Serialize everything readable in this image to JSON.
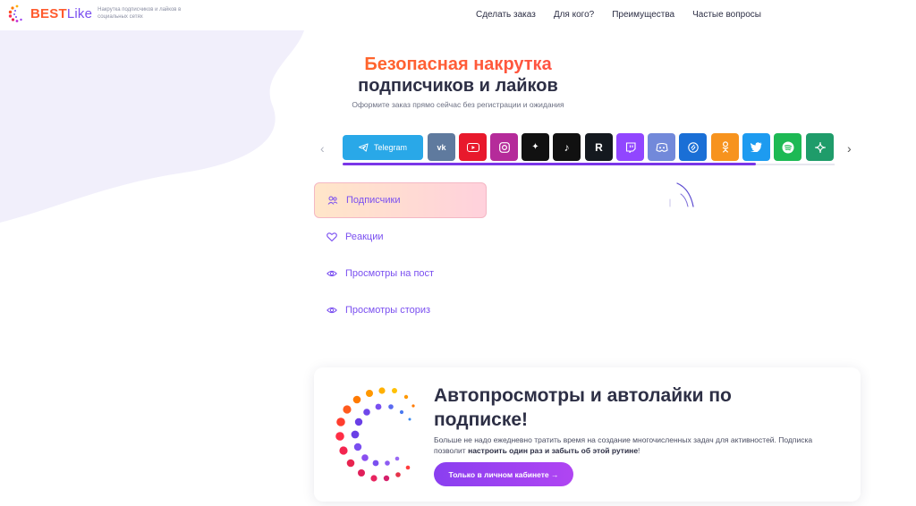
{
  "header": {
    "logo_best": "BEST",
    "logo_like": "Like",
    "tagline": "Накрутка подписчиков и лайков в социальных сетях",
    "nav": [
      "Сделать заказ",
      "Для кого?",
      "Преимущества",
      "Частые вопросы"
    ]
  },
  "hero": {
    "title_line1": "Безопасная накрутка",
    "title_line2": "подписчиков и лайков",
    "subtitle": "Оформите заказ прямо сейчас без регистрации и ожидания"
  },
  "platforms": {
    "selected_label": "Telegram",
    "selected_color": "#29a8e8",
    "items": [
      {
        "icon": "vk-icon",
        "color": "#5f7a9e"
      },
      {
        "icon": "youtube-icon",
        "color": "#e8192c"
      },
      {
        "icon": "instagram-icon",
        "color": "#b52b9a"
      },
      {
        "icon": "threads-icon",
        "color": "#111111"
      },
      {
        "icon": "tiktok-icon",
        "color": "#111111"
      },
      {
        "icon": "rutube-icon",
        "color": "#14191f"
      },
      {
        "icon": "twitch-icon",
        "color": "#9146ff"
      },
      {
        "icon": "discord-icon",
        "color": "#7289da"
      },
      {
        "icon": "shazam-icon",
        "color": "#1a6fd6"
      },
      {
        "icon": "odnoklassniki-icon",
        "color": "#f7931e"
      },
      {
        "icon": "twitter-icon",
        "color": "#1d9bf0"
      },
      {
        "icon": "spotify-icon",
        "color": "#1db954"
      },
      {
        "icon": "dzen-icon",
        "color": "#1f9c6a"
      }
    ],
    "progress": 0.84
  },
  "services": [
    {
      "label": "Подписчики",
      "icon": "users-icon"
    },
    {
      "label": "Реакции",
      "icon": "heart-icon"
    },
    {
      "label": "Просмотры на пост",
      "icon": "eye-icon"
    },
    {
      "label": "Просмотры сториз",
      "icon": "eye-icon"
    }
  ],
  "promo": {
    "title": "Автопросмотры и автолайки по подписке!",
    "text_1": "Больше не надо ежедневно тратить время на создание многочисленных задач для активностей. Подписка позволит ",
    "text_bold": "настроить один раз и забыть об этой рутине",
    "text_2": "!",
    "button": "Только в личном кабинете →"
  }
}
